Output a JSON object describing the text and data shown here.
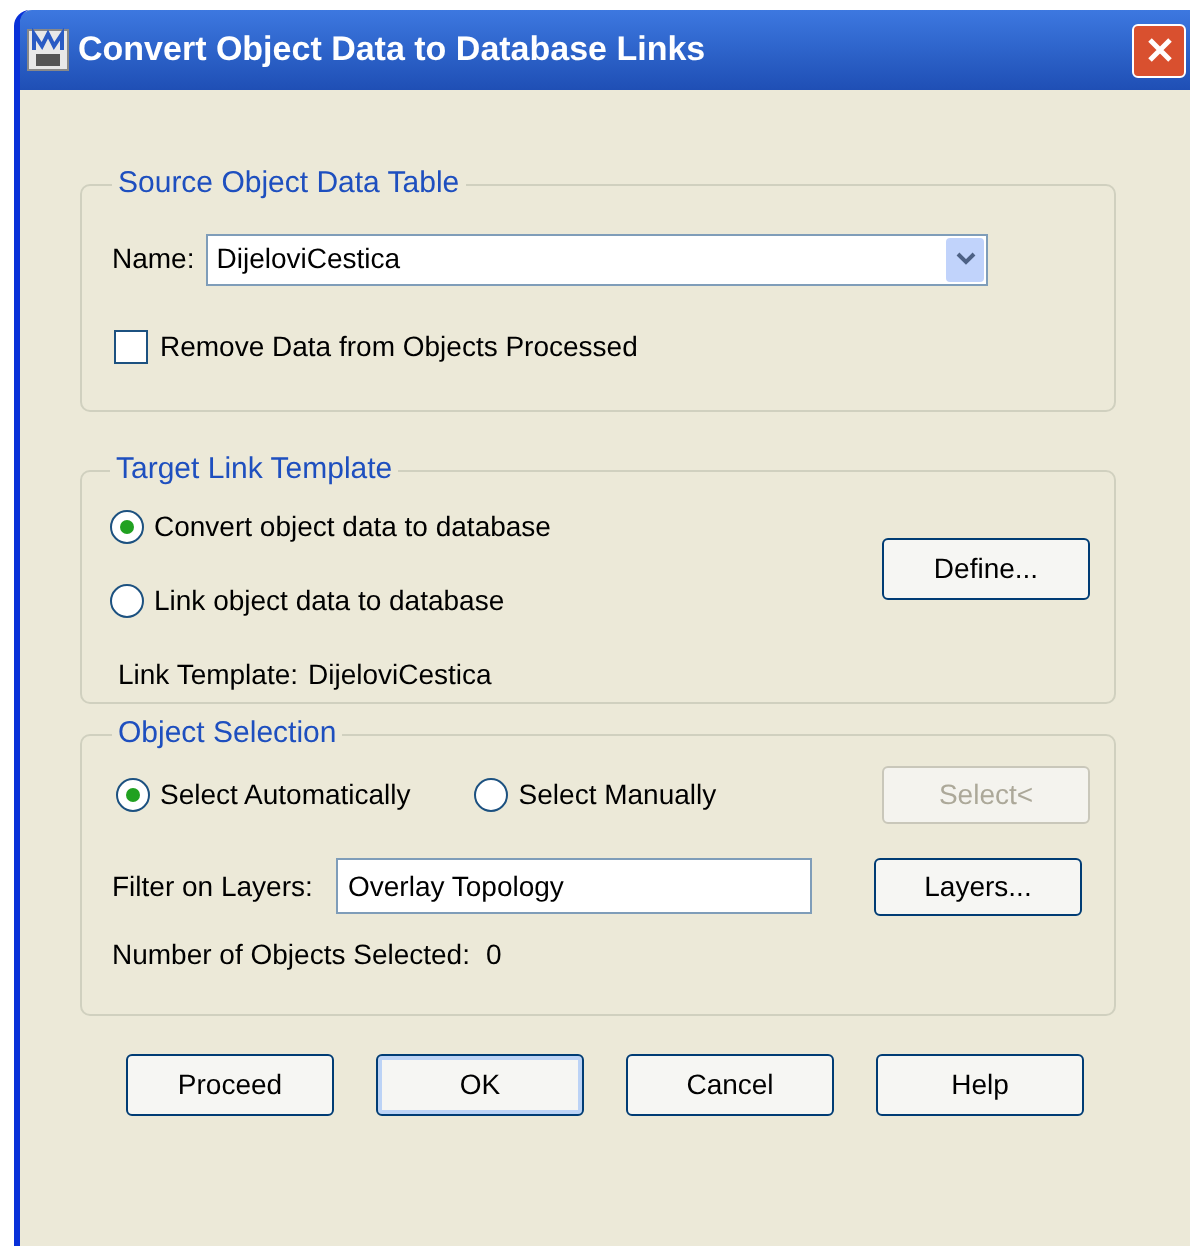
{
  "window": {
    "title": "Convert Object Data to Database Links"
  },
  "source_table": {
    "legend": "Source Object Data Table",
    "name_label": "Name:",
    "name_value": "DijeloviCestica",
    "remove_data": {
      "label": "Remove Data from Objects Processed",
      "checked": false
    }
  },
  "target_link": {
    "legend": "Target Link Template",
    "options": [
      {
        "label": "Convert object data to database",
        "selected": true
      },
      {
        "label": "Link object data to database",
        "selected": false
      }
    ],
    "define_button": "Define...",
    "link_template_label": "Link Template:",
    "link_template_value": "DijeloviCestica"
  },
  "object_selection": {
    "legend": "Object Selection",
    "options": [
      {
        "label": "Select Automatically",
        "selected": true
      },
      {
        "label": "Select Manually",
        "selected": false
      }
    ],
    "select_button": {
      "label": "Select<",
      "disabled": true
    },
    "filter_label": "Filter on Layers:",
    "filter_value": "Overlay Topology",
    "layers_button": "Layers...",
    "count_label": "Number of Objects Selected:",
    "count_value": "0"
  },
  "buttons": [
    {
      "label": "Proceed",
      "default": false
    },
    {
      "label": "OK",
      "default": true
    },
    {
      "label": "Cancel",
      "default": false
    },
    {
      "label": "Help",
      "default": false
    }
  ]
}
